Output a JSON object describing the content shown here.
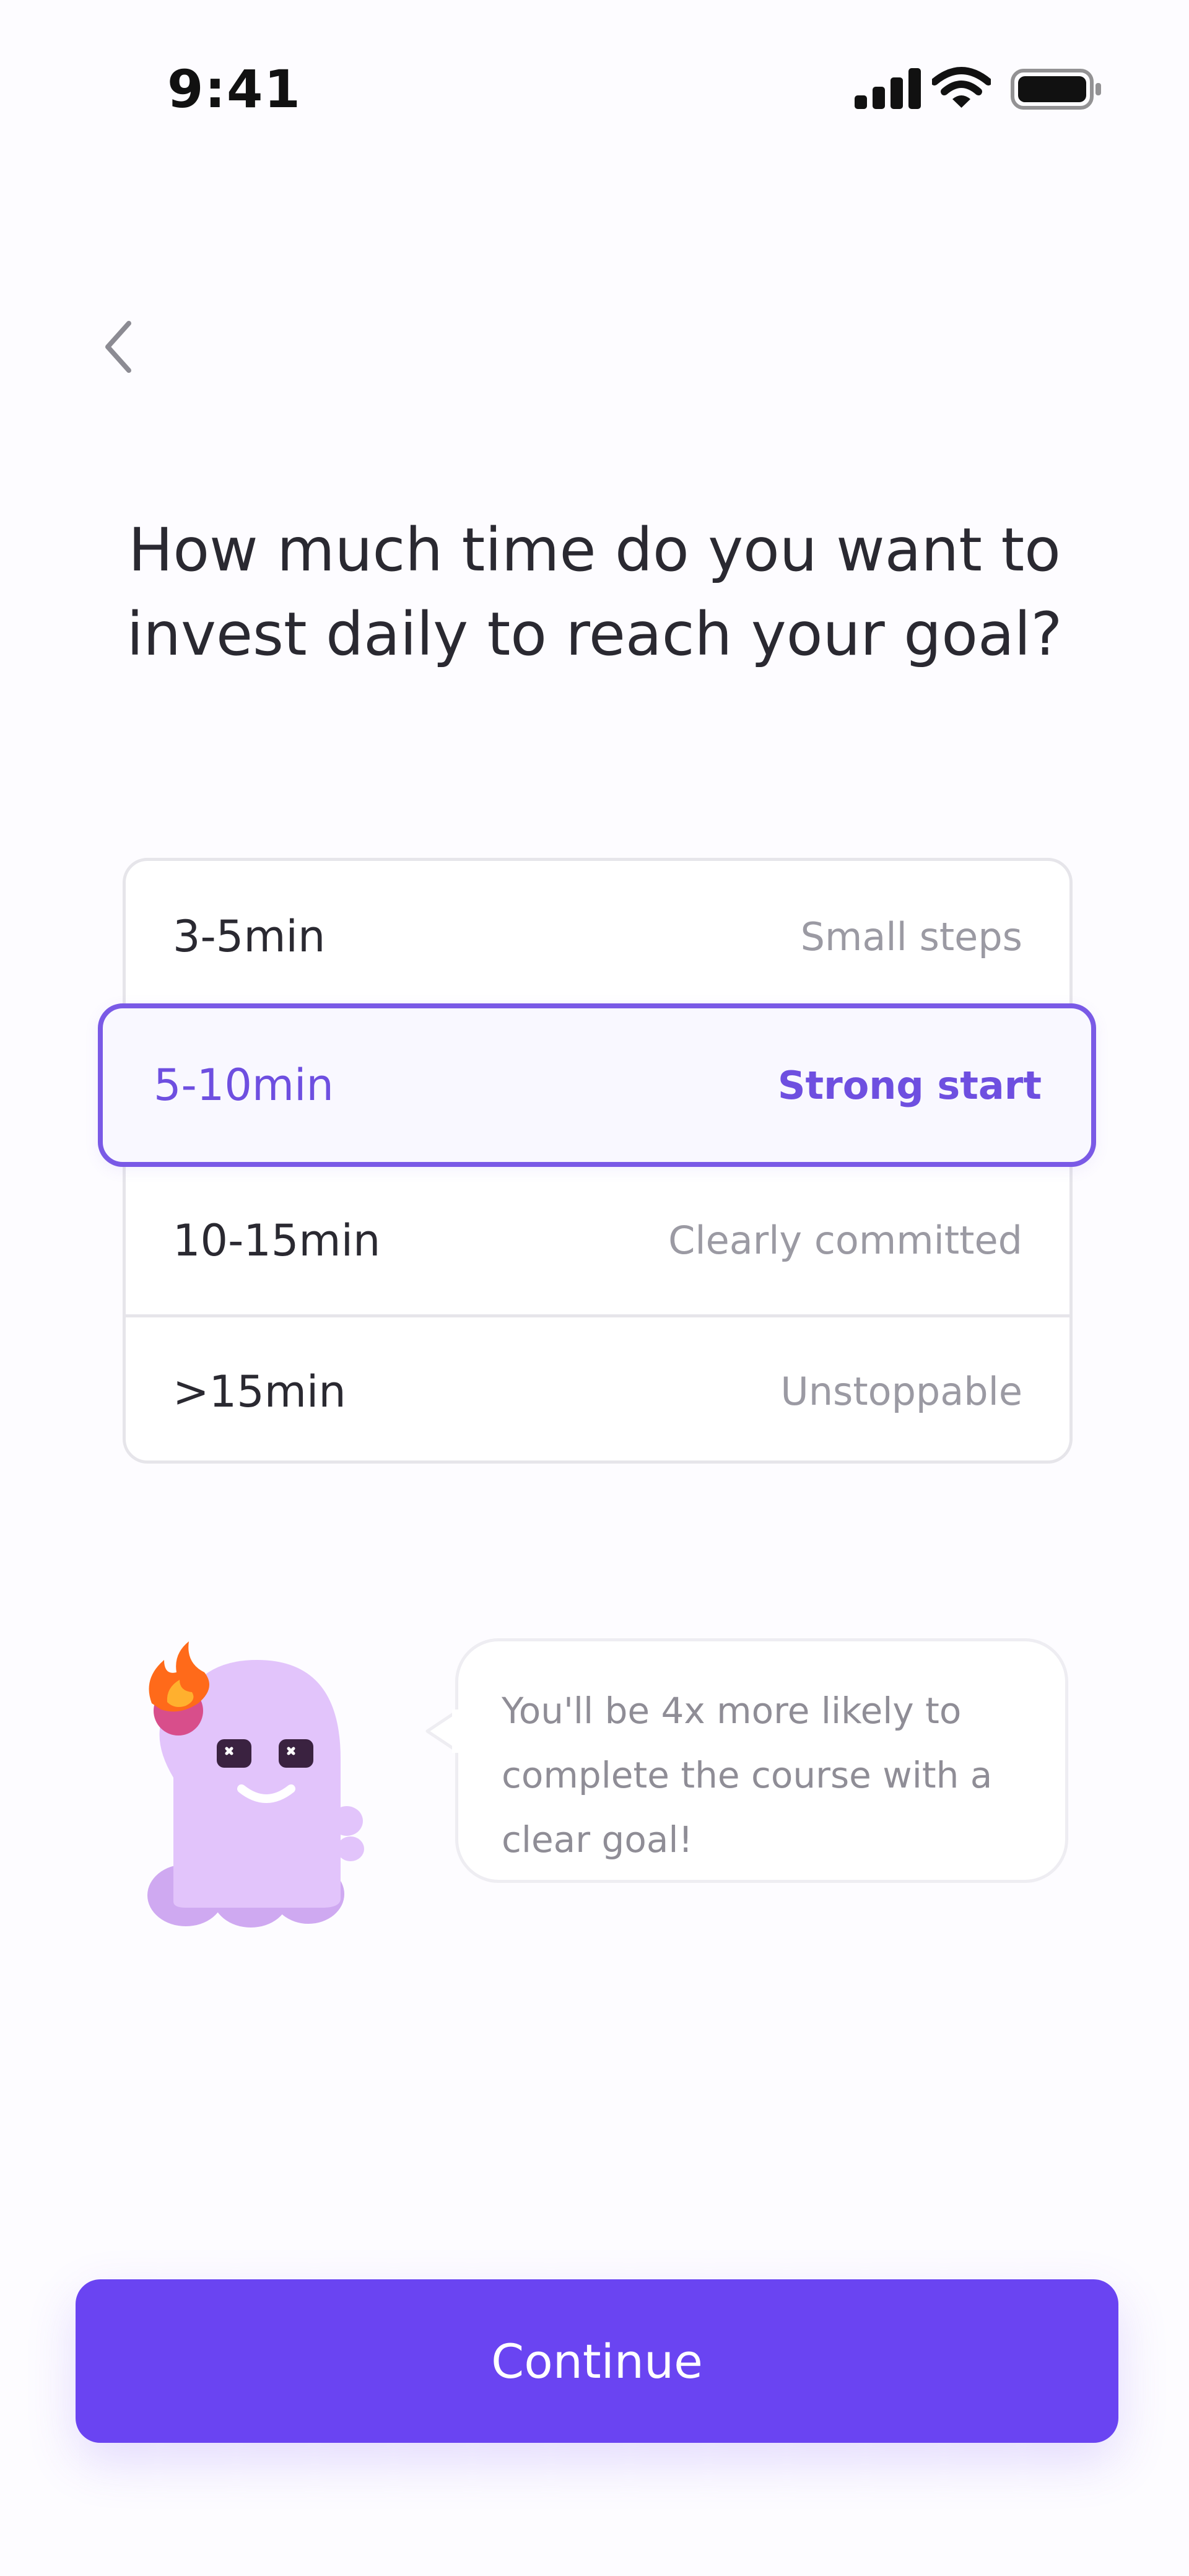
{
  "status_bar": {
    "time": "9:41",
    "icons": [
      "signal-icon",
      "wifi-icon",
      "battery-icon"
    ]
  },
  "nav": {
    "back_icon": "chevron-left-icon"
  },
  "question": "How much time do you want to invest daily to reach your goal?",
  "options": [
    {
      "time": "3-5min",
      "description": "Small steps",
      "selected": false
    },
    {
      "time": "5-10min",
      "description": "Strong start",
      "selected": true
    },
    {
      "time": "10-15min",
      "description": "Clearly committed",
      "selected": false
    },
    {
      "time": ">15min",
      "description": "Unstoppable",
      "selected": false
    }
  ],
  "tip": {
    "mascot_icon": "ghost-mascot-icon",
    "text": "You'll be 4x more likely to complete the course with a clear goal!"
  },
  "continue_label": "Continue",
  "colors": {
    "accent": "#6a44f2",
    "selected_text": "#6e4fe0",
    "selected_border": "#7a5ae6",
    "mascot_body": "#e2c4fb",
    "flame": "#ff6a1a"
  }
}
